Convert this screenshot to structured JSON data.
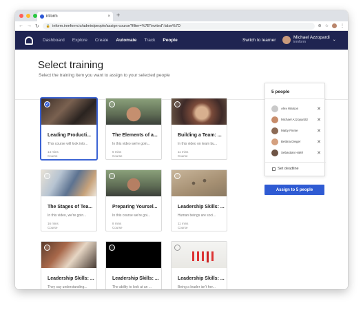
{
  "browser": {
    "tab_title": "inform",
    "url": "inform.inmform.io/admin/people/assign-course?filter=%7B\"invited\":false%7D"
  },
  "nav": {
    "items": [
      {
        "label": "Dashboard"
      },
      {
        "label": "Explore"
      },
      {
        "label": "Create"
      },
      {
        "label": "Automate"
      },
      {
        "label": "Track"
      },
      {
        "label": "People"
      }
    ],
    "switch_label": "Switch to learner",
    "user_name": "Michael Azzopardi",
    "user_org": "inmform"
  },
  "page": {
    "title": "Select training",
    "subtitle": "Select the training item you want to assign to your selected people"
  },
  "cards": [
    {
      "title": "Leading Producti...",
      "desc": "This course will look into...",
      "duration": "14 mins",
      "type": "Course",
      "selected": true
    },
    {
      "title": "The Elements of a...",
      "desc": "In this video we're goin...",
      "duration": "6 mins",
      "type": "Course",
      "selected": false
    },
    {
      "title": "Building a Team: ...",
      "desc": "In this video on team bu...",
      "duration": "11 mins",
      "type": "Course",
      "selected": false
    },
    {
      "title": "The Stages of Tea...",
      "desc": "In this video, we're goin...",
      "duration": "16 mins",
      "type": "Course",
      "selected": false
    },
    {
      "title": "Preparing Yoursel...",
      "desc": "In this course we're goi...",
      "duration": "8 mins",
      "type": "Course",
      "selected": false
    },
    {
      "title": "Leadership Skills: ...",
      "desc": "Human beings are soci...",
      "duration": "11 mins",
      "type": "Course",
      "selected": false
    },
    {
      "title": "Leadership Skills: ...",
      "desc": "They say understanding...",
      "duration": "",
      "type": "",
      "selected": false
    },
    {
      "title": "Leadership Skills: ...",
      "desc": "The ability to look at an ...",
      "duration": "",
      "type": "",
      "selected": false
    },
    {
      "title": "Leadership Skills: ...",
      "desc": "Being a leader isn't her...",
      "duration": "",
      "type": "",
      "selected": false
    }
  ],
  "panel": {
    "title": "5 people",
    "people": [
      {
        "name": "Alex Watson"
      },
      {
        "name": "Michael Azzopardi2"
      },
      {
        "name": "Matty Finnie"
      },
      {
        "name": "Bettina Dieger"
      },
      {
        "name": "Sebastian Hafel"
      }
    ],
    "deadline_label": "Set deadline"
  },
  "assign_label": "Assign to 5 people",
  "colors": {
    "nav_bg": "#1f2451",
    "accent": "#2f5bd3"
  }
}
